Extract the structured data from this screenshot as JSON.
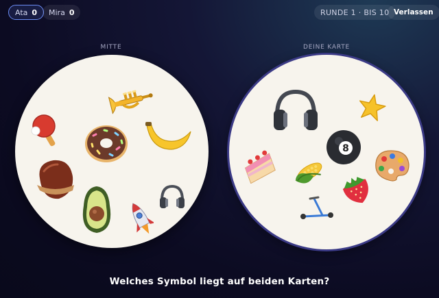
{
  "players": [
    {
      "name": "Ata",
      "score": "0"
    },
    {
      "name": "Mira",
      "score": "0"
    }
  ],
  "round_text": "RUNDE 1 · BIS 10",
  "leave_label": "Verlassen",
  "center_card": {
    "label": "MITTE",
    "symbols": [
      "trumpet-icon",
      "ping-pong-icon",
      "donut-icon",
      "banana-icon",
      "chestnut-icon",
      "avocado-icon",
      "rocket-icon",
      "headphones-icon"
    ]
  },
  "own_card": {
    "label": "DEINE KARTE",
    "symbols": [
      "headphones-icon",
      "star-icon",
      "cake-icon",
      "eight-ball-icon",
      "corn-icon",
      "palette-icon",
      "strawberry-icon",
      "scooter-icon"
    ]
  },
  "question": "Welches Symbol liegt auf beiden Karten?"
}
